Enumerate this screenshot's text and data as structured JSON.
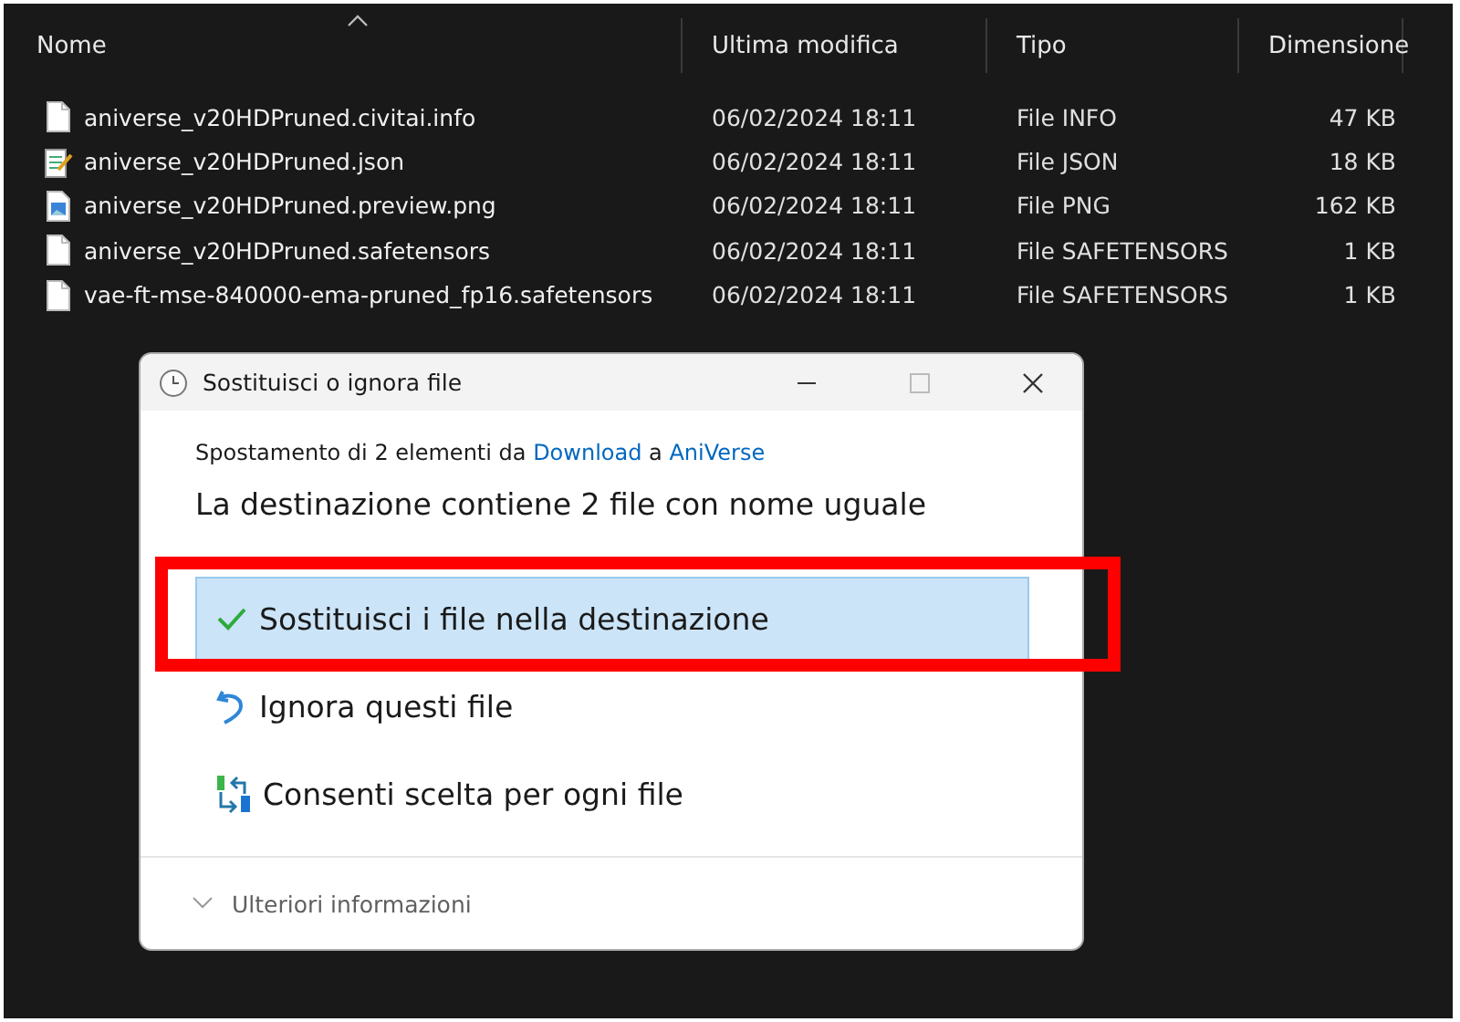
{
  "explorer": {
    "columns": [
      {
        "label": "Nome",
        "sorted": true
      },
      {
        "label": "Ultima modifica",
        "sorted": false
      },
      {
        "label": "Tipo",
        "sorted": false
      },
      {
        "label": "Dimensione",
        "sorted": false
      }
    ],
    "rows": [
      {
        "kind": "blank",
        "name": "aniverse_v20HDPruned.civitai.info",
        "modified": "06/02/2024 18:11",
        "type": "File INFO",
        "size": "47 KB"
      },
      {
        "kind": "notepad",
        "name": "aniverse_v20HDPruned.json",
        "modified": "06/02/2024 18:11",
        "type": "File JSON",
        "size": "18 KB"
      },
      {
        "kind": "image",
        "name": "aniverse_v20HDPruned.preview.png",
        "modified": "06/02/2024 18:11",
        "type": "File PNG",
        "size": "162 KB"
      },
      {
        "kind": "blank",
        "name": "aniverse_v20HDPruned.safetensors",
        "modified": "06/02/2024 18:11",
        "type": "File SAFETENSORS",
        "size": "1 KB"
      },
      {
        "kind": "blank",
        "name": "vae-ft-mse-840000-ema-pruned_fp16.safetensors",
        "modified": "06/02/2024 18:11",
        "type": "File SAFETENSORS",
        "size": "1 KB"
      }
    ]
  },
  "dialog": {
    "title": "Sostituisci o ignora file",
    "summary": "Spostamento di 2 elementi da ",
    "source": "Download",
    "joiner": " a ",
    "destination": "AniVerse",
    "heading": "La destinazione contiene 2 file con nome uguale",
    "options": [
      {
        "kind": "replace",
        "label": "Sostituisci i file nella destinazione",
        "selected": true,
        "annotated": true
      },
      {
        "kind": "skip",
        "label": "Ignora questi file",
        "selected": false,
        "annotated": false
      },
      {
        "kind": "choose",
        "label": "Consenti scelta per ogni file",
        "selected": false,
        "annotated": false
      }
    ],
    "details": "Ulteriori informazioni"
  }
}
